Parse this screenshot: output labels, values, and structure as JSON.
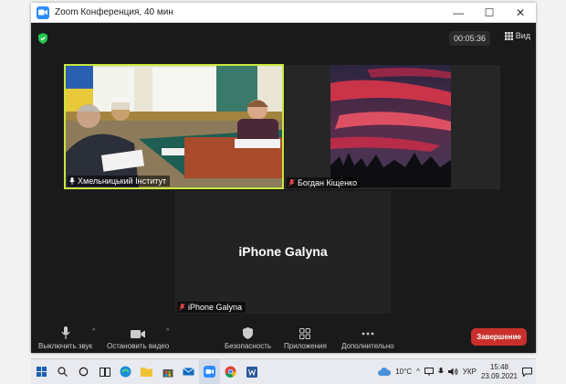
{
  "window": {
    "title": "Zoom Конференция, 40 мин",
    "minimize": "—",
    "maximize": "☐",
    "close": "✕"
  },
  "meeting": {
    "timer": "00:05:36",
    "view_label": "Вид"
  },
  "participants": [
    {
      "label": "Хмельницький Інститут"
    },
    {
      "label": "Богдан Кіщенко"
    },
    {
      "label": "iPhone Galyna",
      "display_name": "iPhone Galyna"
    }
  ],
  "toolbar": {
    "mute": "Выключить звук",
    "video": "Остановить видео",
    "security": "Безопасность",
    "apps": "Приложения",
    "more": "Дополнительно",
    "end": "Завершение"
  },
  "taskbar": {
    "weather": "10°C",
    "language": "УКР",
    "time": "15:48",
    "date": "23.09.2021"
  },
  "colors": {
    "zoom_blue": "#2d8cff",
    "active_speaker": "#c8e63c",
    "end_red": "#c9302c"
  }
}
